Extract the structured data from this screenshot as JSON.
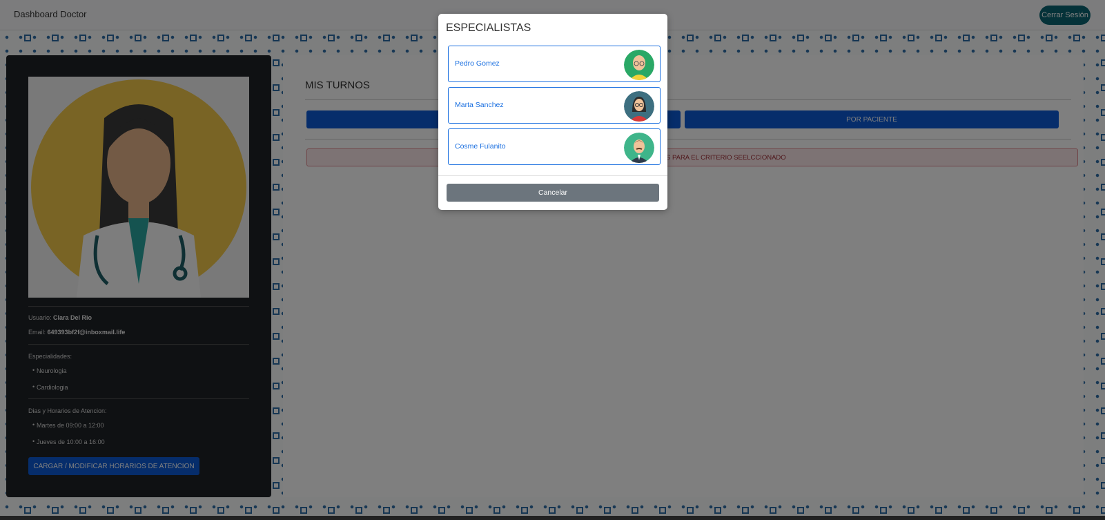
{
  "navbar": {
    "brand": "Dashboard Doctor",
    "logout_label": "Cerrar Sesión"
  },
  "profile": {
    "user_label": "Usuario:",
    "user_value": "Clara Del Rio",
    "email_label": "Email:",
    "email_value": "649393bf2f@inboxmail.life",
    "specialties_label": "Especialidades:",
    "specialties": [
      "Neurologia",
      "Cardiologia"
    ],
    "schedule_label": "Dias y Horarios de Atencion:",
    "schedule": [
      "Martes de 09:00 a 12:00",
      "Jueves de 10:00 a 16:00"
    ],
    "schedule_button": "CARGAR / MODIFICAR HORARIOS DE ATENCION"
  },
  "main": {
    "title": "MIS TURNOS",
    "filter_specialist_visible": "",
    "filter_patient": "POR PACIENTE",
    "alert_visible_text": "S PARA EL CRITERIO SEELCCIONADO"
  },
  "modal": {
    "title": "ESPECIALISTAS",
    "specialists": [
      {
        "name": "Pedro Gomez",
        "avatar": "bald-man-glasses-icon",
        "bg": "#2aa866"
      },
      {
        "name": "Marta Sanchez",
        "avatar": "woman-glasses-icon",
        "bg": "#3d6f80"
      },
      {
        "name": "Cosme Fulanito",
        "avatar": "man-mustache-icon",
        "bg": "#3fb58a"
      }
    ],
    "cancel_label": "Cancelar"
  },
  "colors": {
    "primary": "#0d5bd7",
    "logout": "#0b6473",
    "card": "#1f2226",
    "cancel": "#6c757d"
  }
}
